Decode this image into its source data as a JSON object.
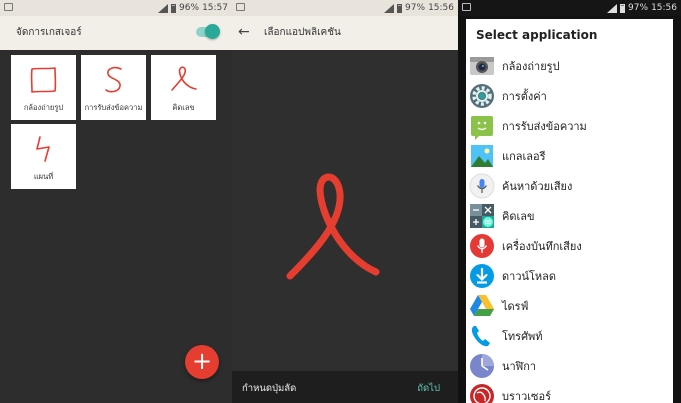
{
  "panel1": {
    "status": {
      "battery": "96%",
      "time": "15:57"
    },
    "title": "จัดการเกสเจอร์",
    "toggle_on": true,
    "tiles": [
      {
        "label": "กล้องถ่ายรูป",
        "icon": "square-gesture-icon"
      },
      {
        "label": "การรับส่งข้อความ",
        "icon": "s-gesture-icon"
      },
      {
        "label": "คิดเลข",
        "icon": "loop-gesture-icon"
      },
      {
        "label": "แผนที่",
        "icon": "zigzag-gesture-icon"
      }
    ],
    "fab_label": "+"
  },
  "panel2": {
    "status": {
      "battery": "97%",
      "time": "15:56"
    },
    "title": "เลือกแอปพลิเคชัน",
    "snackbar": {
      "message": "กำหนดปุ่มลัด",
      "action": "ถัดไป"
    }
  },
  "panel3": {
    "status": {
      "battery": "97%",
      "time": "15:56"
    },
    "dialog_title": "Select application",
    "apps": [
      {
        "name": "กล้องถ่ายรูป",
        "icon": "camera-icon"
      },
      {
        "name": "การตั้งค่า",
        "icon": "settings-gear-icon"
      },
      {
        "name": "การรับส่งข้อความ",
        "icon": "messaging-icon"
      },
      {
        "name": "แกลเลอรี",
        "icon": "gallery-icon"
      },
      {
        "name": "ค้นหาด้วยเสียง",
        "icon": "voice-search-icon"
      },
      {
        "name": "คิดเลข",
        "icon": "calculator-icon"
      },
      {
        "name": "เครื่องบันทึกเสียง",
        "icon": "sound-recorder-icon"
      },
      {
        "name": "ดาวน์โหลด",
        "icon": "download-icon"
      },
      {
        "name": "ไดรฟ์",
        "icon": "drive-icon"
      },
      {
        "name": "โทรศัพท์",
        "icon": "phone-icon"
      },
      {
        "name": "นาฬิกา",
        "icon": "clock-icon"
      },
      {
        "name": "บราวเซอร์",
        "icon": "browser-icon"
      }
    ]
  },
  "colors": {
    "accent": "#2aa89a",
    "gesture_red": "#e53d2f",
    "tile_bg": "#ffffff"
  }
}
